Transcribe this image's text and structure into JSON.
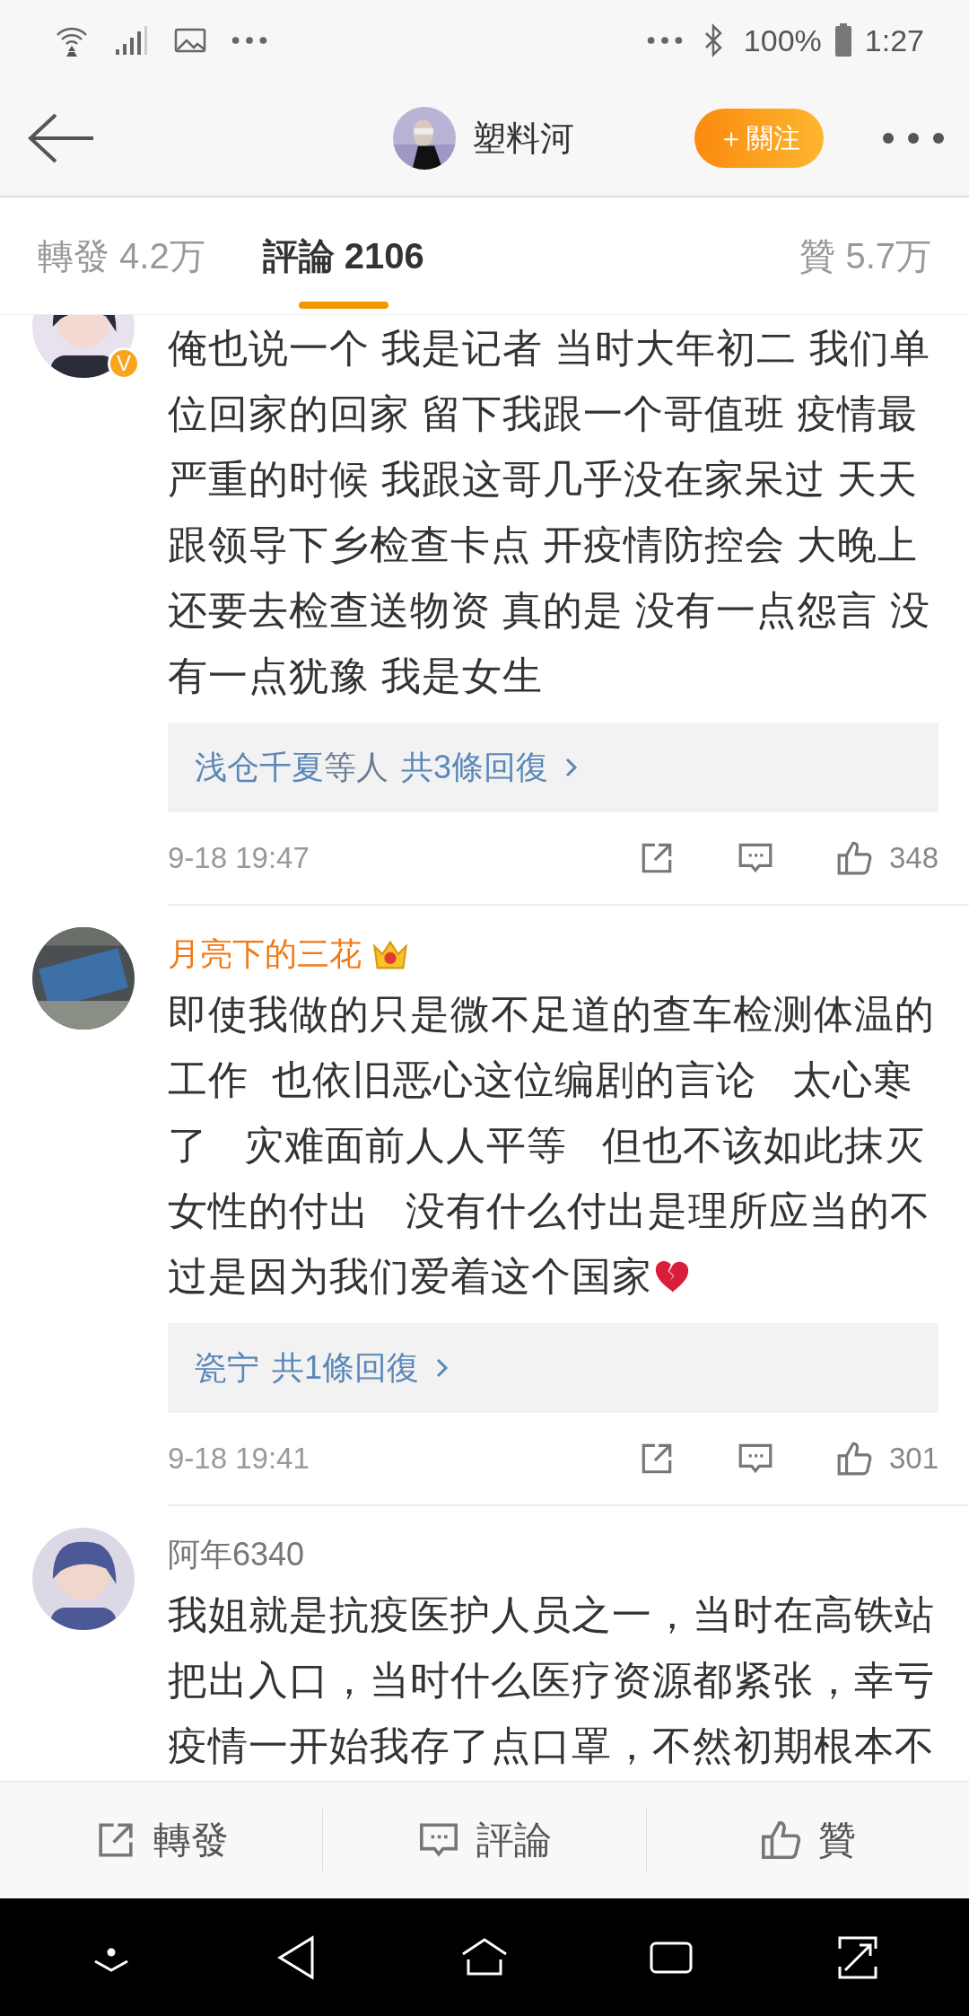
{
  "status_bar": {
    "battery": "100%",
    "time": "1:27"
  },
  "header": {
    "username": "塑料河",
    "follow_button": {
      "plus": "＋",
      "label": "關注"
    }
  },
  "tabs": [
    {
      "label": "轉發 4.2万",
      "selected": false
    },
    {
      "label": "評論 2106",
      "selected": true
    },
    {
      "label": "贊 5.7万",
      "selected": false
    }
  ],
  "comments": [
    {
      "badge": "V",
      "text": "俺也说一个 我是记者 当时大年初二 我们单位回家的回家 留下我跟一个哥值班 疫情最严重的时候 我跟这哥几乎没在家呆过 天天跟领导下乡检查卡点 开疫情防控会 大晚上还要去检查送物资 真的是 没有一点怨言 没有一点犹豫 我是女生",
      "replies": {
        "names": "浅仓千夏",
        "others": "等人",
        "count": "共3條回復"
      },
      "date": "9-18 19:47",
      "likes": "348"
    },
    {
      "name": "月亮下的三花",
      "vip": true,
      "crown": true,
      "text": "即使我做的只是微不足道的查车检测体温的工作  也依旧恶心这位编剧的言论   太心寒了   灾难面前人人平等   但也不该如此抹灭女性的付出   没有什么付出是理所应当的不过是因为我们爱着这个国家",
      "broken_heart": true,
      "replies": {
        "names": "瓷宁",
        "count": "共1條回復"
      },
      "date": "9-18 19:41",
      "likes": "301"
    },
    {
      "name": "阿年6340",
      "vip": false,
      "text": "我姐就是抗疫医护人员之一，当时在高铁站把出入口，当时什么医疗资源都紧张，幸亏疫情一开始我存了点口罩，不然初期根本不"
    }
  ],
  "bottom_bar": [
    {
      "kind": "repost",
      "label": "轉發"
    },
    {
      "kind": "comment",
      "label": "評論"
    },
    {
      "kind": "like",
      "label": "贊"
    }
  ]
}
